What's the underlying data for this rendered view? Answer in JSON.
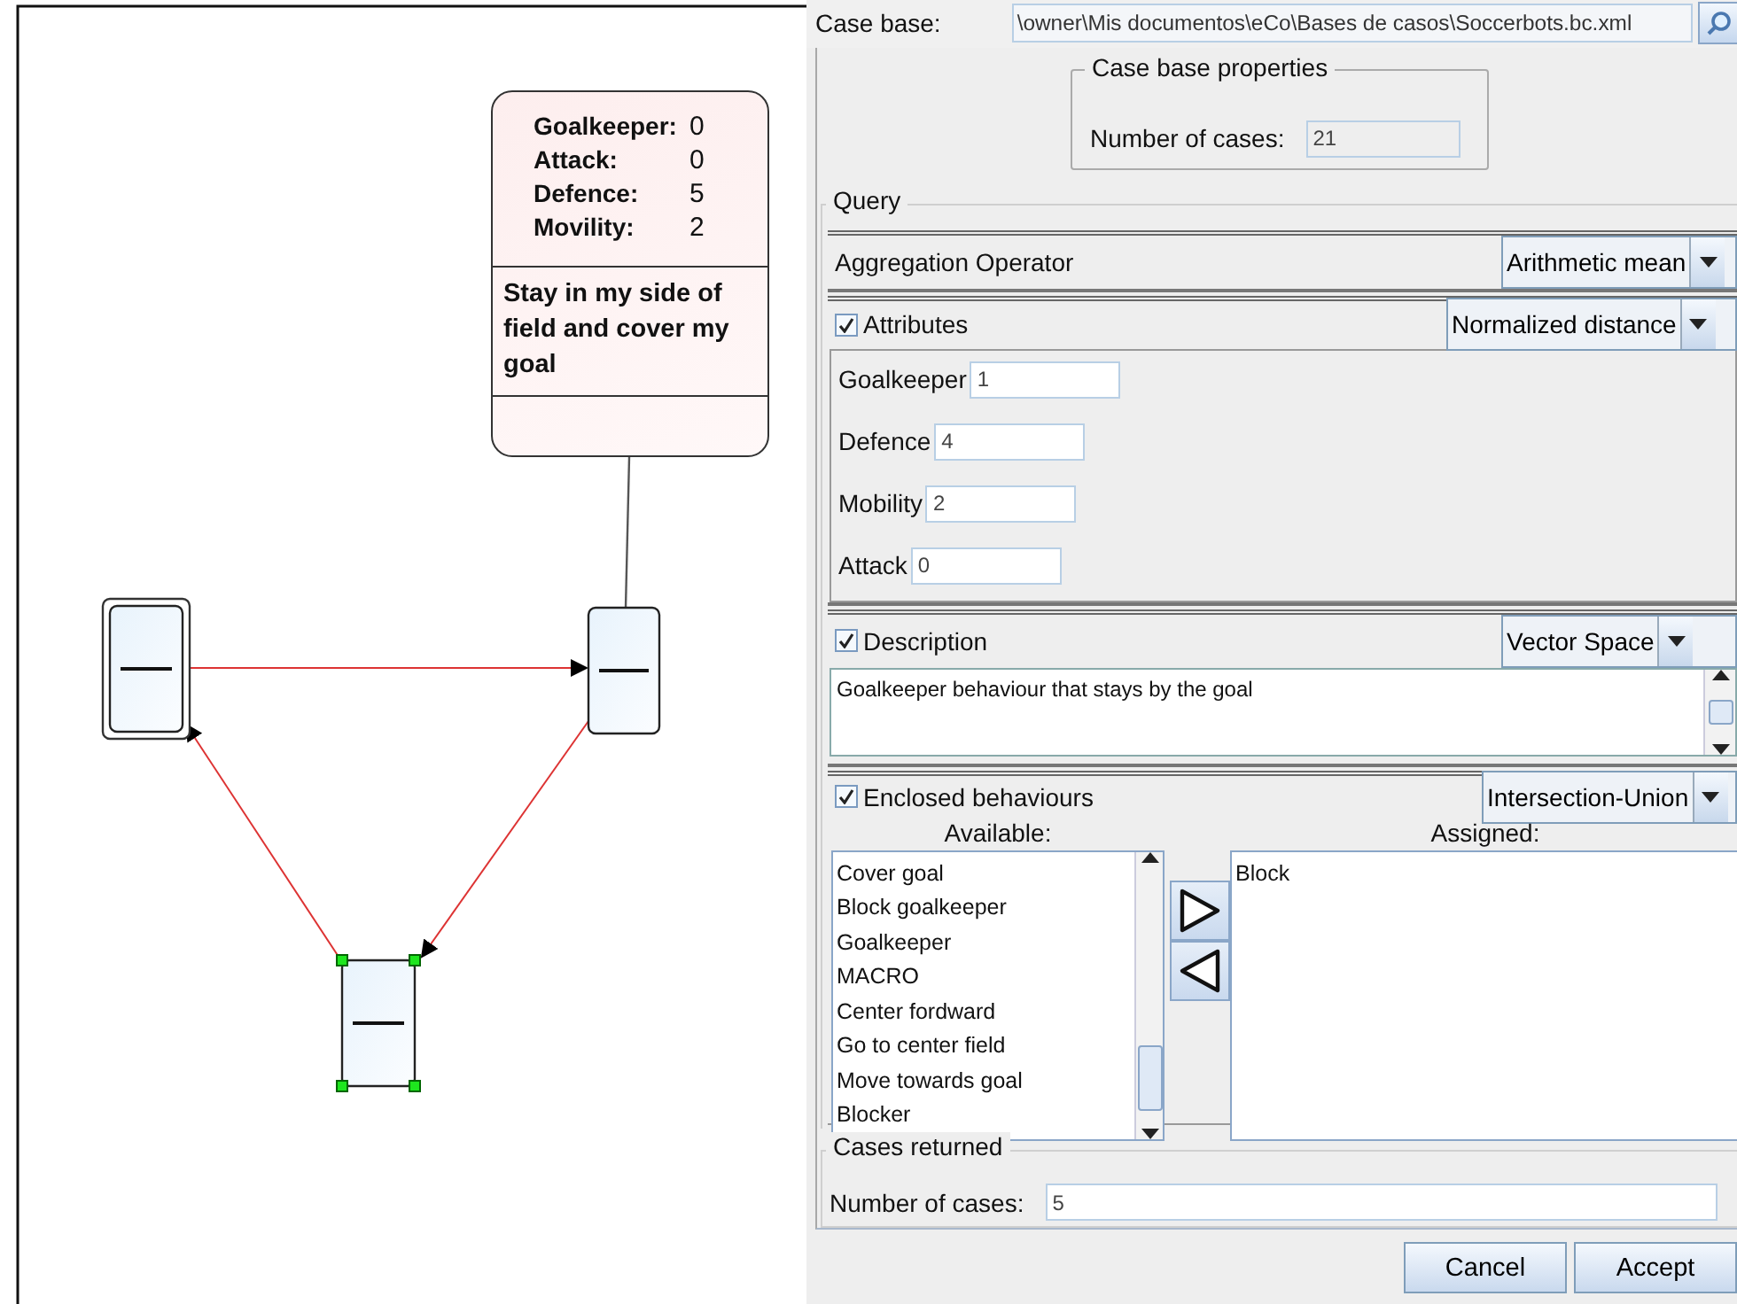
{
  "diagram": {
    "nodes": [
      {
        "kind": "double",
        "selected": false
      },
      {
        "kind": "single",
        "selected": false
      },
      {
        "kind": "single",
        "selected": true
      }
    ],
    "note": {
      "attributes": [
        {
          "name": "Goalkeeper:",
          "value": "0"
        },
        {
          "name": "Attack:",
          "value": "0"
        },
        {
          "name": "Defence:",
          "value": "5"
        },
        {
          "name": "Movility:",
          "value": "2"
        }
      ],
      "description": "Stay in my side of field and cover my goal"
    }
  },
  "case_base": {
    "label": "Case base:",
    "path": "\\owner\\Mis documentos\\eCo\\Bases de casos\\Soccerbots.bc.xml"
  },
  "case_base_properties": {
    "title": "Case base properties",
    "label": "Number of cases:",
    "value": "21"
  },
  "query": {
    "title": "Query",
    "aggregation": {
      "label": "Aggregation Operator",
      "value": "Arithmetic mean"
    },
    "attributes": {
      "label": "Attributes",
      "checked": true,
      "method": "Normalized distance",
      "fields": [
        {
          "label": "Goalkeeper",
          "value": "1"
        },
        {
          "label": "Defence",
          "value": "4"
        },
        {
          "label": "Mobility",
          "value": "2"
        },
        {
          "label": "Attack",
          "value": "0"
        }
      ]
    },
    "description": {
      "label": "Description",
      "checked": true,
      "method": "Vector Space",
      "text": "Goalkeeper behaviour that stays by the goal"
    },
    "behaviours": {
      "label": "Enclosed behaviours",
      "checked": true,
      "method": "Intersection-Union",
      "available_title": "Available:",
      "assigned_title": "Assigned:",
      "available": [
        "Cover goal",
        "Block goalkeeper",
        "Goalkeeper",
        "MACRO",
        "Center fordward",
        "Go to center field",
        "Move towards goal",
        "Blocker"
      ],
      "assigned": [
        "Block"
      ]
    }
  },
  "cases_returned": {
    "title": "Cases returned",
    "label": "Number of cases:",
    "value": "5"
  },
  "buttons": [
    "Cancel",
    "Accept"
  ]
}
